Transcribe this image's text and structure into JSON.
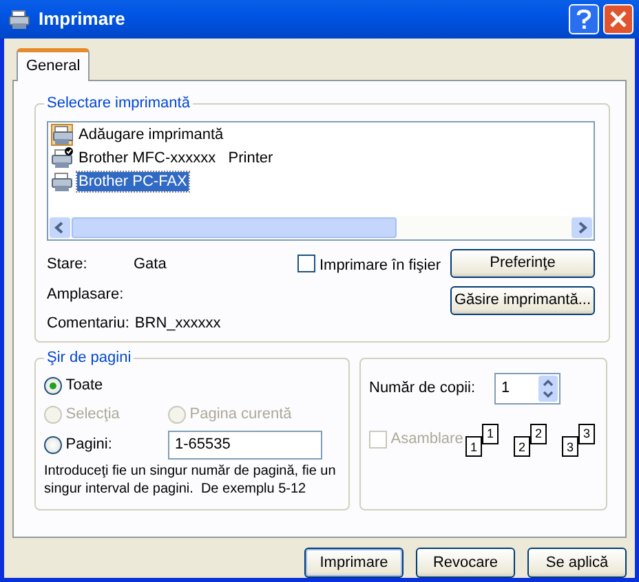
{
  "window": {
    "title": "Imprimare"
  },
  "tabs": [
    {
      "label": "General",
      "selected": true
    }
  ],
  "printer_group": {
    "legend": "Selectare imprimantă",
    "printers": [
      {
        "name": "Adăugare imprimantă",
        "kind": "add",
        "selected": false
      },
      {
        "name": "Brother MFC-xxxxxx   Printer",
        "kind": "default",
        "selected": false
      },
      {
        "name": "Brother PC-FAX",
        "kind": "printer",
        "selected": true
      }
    ],
    "details": [
      {
        "label": "Stare:",
        "value": "Gata"
      },
      {
        "label": "Amplasare:"
      },
      {
        "label": "Comentariu:",
        "value": "BRN_xxxxxx"
      }
    ],
    "print_to_file": {
      "label": "Imprimare în fişier",
      "checked": false
    },
    "buttons": [
      "Preferinţe",
      "Găsire imprimantă..."
    ]
  },
  "page_range": {
    "legend": "Şir de pagini",
    "rows": [
      [
        {
          "label": "Toate",
          "selected": true,
          "disabled": false
        }
      ],
      [
        {
          "label": "Selecţia",
          "selected": false,
          "disabled": true
        },
        {
          "label": "Pagina curentă",
          "selected": false,
          "disabled": true
        }
      ],
      [
        {
          "label": "Pagini:",
          "selected": false,
          "disabled": false,
          "value": "1-65535"
        }
      ]
    ],
    "hint": "Introduceţi fie un singur număr de pagină, fie un singur interval de pagini.  De exemplu 5-12"
  },
  "copies": {
    "label": "Număr de copii:",
    "value": "1",
    "collate": {
      "label": "Asamblare",
      "checked": false,
      "disabled": true
    },
    "stacks": [
      {
        "back": "1",
        "front": "1"
      },
      {
        "back": "2",
        "front": "2"
      },
      {
        "back": "3",
        "front": "3"
      }
    ]
  },
  "buttons": [
    {
      "label": "Imprimare",
      "kind": "default"
    },
    {
      "label": "Revocare",
      "kind": "normal"
    },
    {
      "label": "Se aplică",
      "kind": "normal"
    }
  ]
}
